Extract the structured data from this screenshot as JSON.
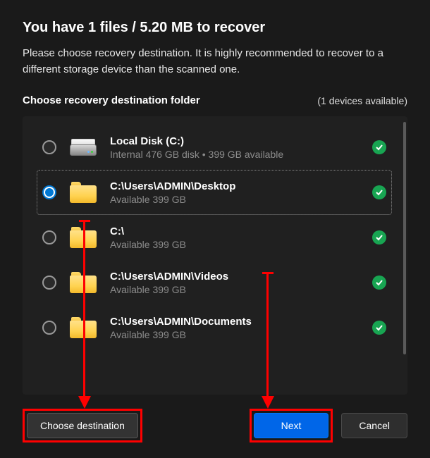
{
  "header": {
    "title": "You have 1 files / 5.20 MB to recover",
    "subtitle": "Please choose recovery destination. It is highly recommended to recover to a different storage device than the scanned one."
  },
  "section": {
    "label": "Choose recovery destination folder",
    "devices": "(1 devices available)"
  },
  "items": [
    {
      "title": "Local Disk (C:)",
      "subtitle": "Internal 476 GB disk • 399 GB available",
      "icon": "disk",
      "selected": false,
      "ok": true
    },
    {
      "title": "C:\\Users\\ADMIN\\Desktop",
      "subtitle": "Available 399 GB",
      "icon": "folder",
      "selected": true,
      "ok": true
    },
    {
      "title": "C:\\",
      "subtitle": "Available 399 GB",
      "icon": "folder",
      "selected": false,
      "ok": true
    },
    {
      "title": "C:\\Users\\ADMIN\\Videos",
      "subtitle": "Available 399 GB",
      "icon": "folder",
      "selected": false,
      "ok": true
    },
    {
      "title": "C:\\Users\\ADMIN\\Documents",
      "subtitle": "Available 399 GB",
      "icon": "folder",
      "selected": false,
      "ok": true
    }
  ],
  "buttons": {
    "choose": "Choose destination",
    "next": "Next",
    "cancel": "Cancel"
  },
  "colors": {
    "accent": "#0066e8",
    "success": "#18a552",
    "annotation": "#ff0000"
  }
}
